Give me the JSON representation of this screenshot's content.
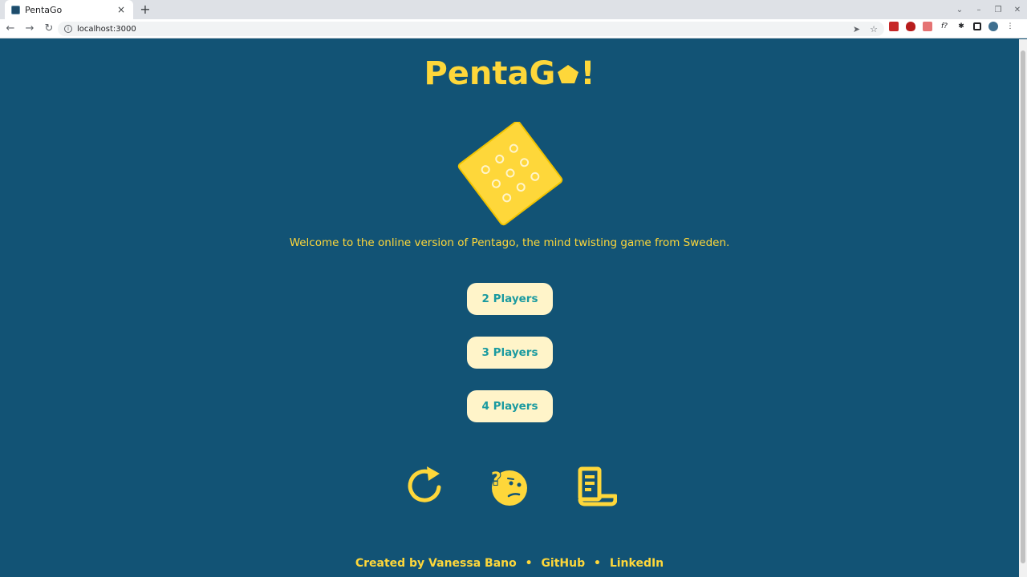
{
  "browser": {
    "tab_title": "PentaGo",
    "url": "localhost:3000",
    "new_tab_glyph": "+",
    "tab_close_glyph": "×"
  },
  "logo": {
    "text_left": "PentaG",
    "text_right": "!",
    "pentagon_color": "#fed73a"
  },
  "welcome_text": "Welcome to the online version of Pentago, the mind twisting game from Sweden.",
  "player_buttons": [
    {
      "label": "2 Players"
    },
    {
      "label": "3 Players"
    },
    {
      "label": "4 Players"
    }
  ],
  "icon_buttons": [
    {
      "icon": "restart-icon"
    },
    {
      "icon": "confused-face-icon"
    },
    {
      "icon": "scroll-icon"
    }
  ],
  "footer": {
    "created_by": "Created by Vanessa Bano",
    "separator": "•",
    "github": "GitHub",
    "linkedin": "LinkedIn"
  },
  "colors": {
    "background": "#125375",
    "accent": "#fed73a",
    "button_bg": "#fff4c9",
    "button_text": "#1a9aa0"
  }
}
